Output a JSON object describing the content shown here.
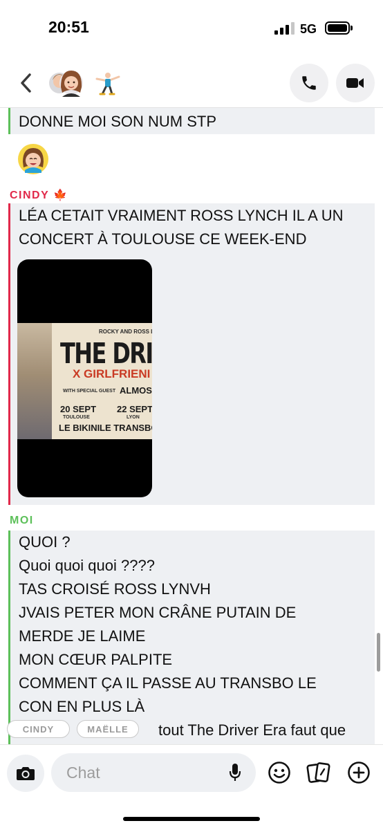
{
  "status_bar": {
    "time": "20:51",
    "network": "5G",
    "signal_bars_filled": 3,
    "signal_bars_total": 4
  },
  "header": {
    "back_icon": "chevron-left-icon",
    "call_icon": "phone-icon",
    "video_icon": "video-camera-icon"
  },
  "messages": {
    "top_block": {
      "lines": [
        "DONNE MOI SON NUM STP"
      ]
    },
    "cindy": {
      "sender": "CINDY",
      "sender_emoji": "🍁",
      "lines": [
        "LÉA CETAIT VRAIMENT ROSS LYNCH IL A UN",
        "CONCERT À TOULOUSE CE WEEK-END"
      ],
      "poster": {
        "top_text": "ROCKY AND ROSS LYNCH",
        "title": "THE DRIVE",
        "subtitle": "X GIRLFRIENI",
        "guest_label": "WITH SPECIAL GUEST",
        "guest_name": "ALMOS",
        "date1": "20 SEPT",
        "city1": "TOULOUSE",
        "venue1": "LE BIKINI",
        "date2": "22 SEPT",
        "city2": "LYON",
        "venue2": "LE TRANSBORDI"
      }
    },
    "moi": {
      "sender": "MOI",
      "lines": [
        "QUOI ?",
        "Quoi quoi quoi ????",
        "TAS CROISÉ ROSS LYNVH",
        "JVAIS PETER MON CRÂNE PUTAIN DE",
        "MERDE JE LAIME",
        "MON CŒUR PALPITE",
        "COMMENT ÇA IL PASSE AU TRANSBO LE",
        "CON EN PLUS LÀ"
      ],
      "partial_line": "tout The Driver Era faut que"
    }
  },
  "typing_chips": [
    "CINDY",
    "MAËLLE"
  ],
  "composer": {
    "placeholder": "Chat",
    "icons": [
      "camera-icon",
      "microphone-icon",
      "smiley-icon",
      "cards-icon",
      "plus-icon"
    ]
  },
  "colors": {
    "friend_accent": "#e1294a",
    "me_accent": "#5dc05a",
    "bubble_bg": "#eef0f3"
  }
}
